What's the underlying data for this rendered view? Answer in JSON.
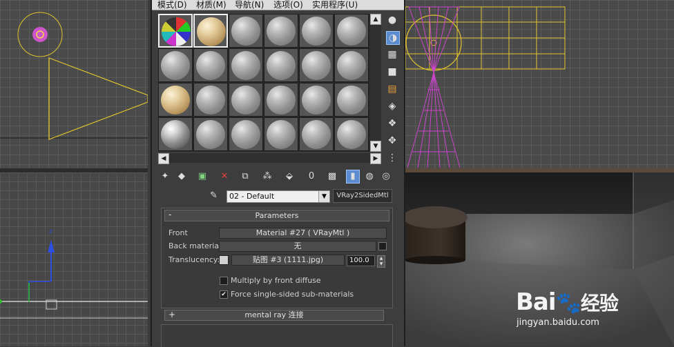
{
  "menu": {
    "items": [
      "模式(D)",
      "材质(M)",
      "导航(N)",
      "选项(O)",
      "实用程序(U)"
    ]
  },
  "toolbar": {
    "material_name": "02 - Default",
    "material_type": "VRay2SidedMtl"
  },
  "parameters": {
    "title": "Parameters",
    "collapse_sign": "-",
    "front_label": "Front",
    "front_value": "Material #27  ( VRayMtl )",
    "back_label": "Back material:",
    "back_value": "无",
    "translucency_label": "Translucency:",
    "translucency_map": "贴图 #3 (1111.jpg)",
    "translucency_amount": "100.0",
    "multiply_label": "Multiply by front diffuse",
    "multiply_checked": false,
    "force_label": "Force single-sided sub-materials",
    "force_checked": true
  },
  "mental_ray": {
    "sign": "+",
    "label": "mental ray 连接"
  },
  "watermark": {
    "brand": "Bai",
    "brand2": "经验",
    "url": "jingyan.baidu.com"
  },
  "colors": {
    "accent_active": "#5b8ccf",
    "wire_yellow": "#e3c52d",
    "wire_magenta": "#cc44cc"
  }
}
